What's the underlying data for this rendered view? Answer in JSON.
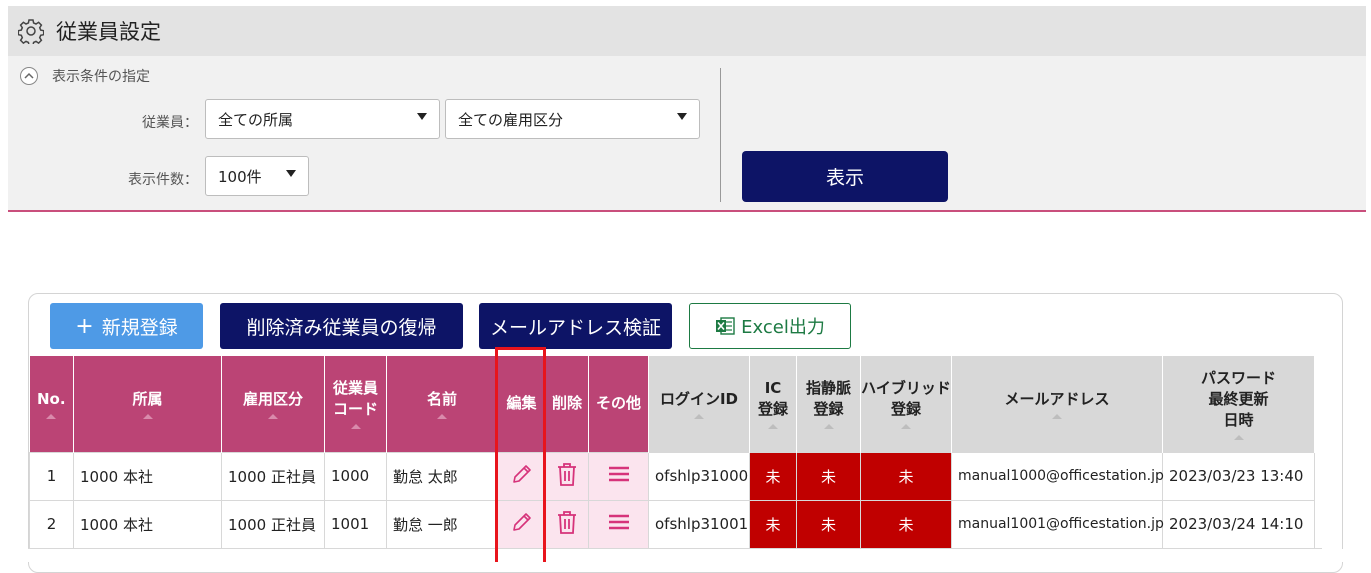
{
  "header": {
    "title": "従業員設定"
  },
  "filter": {
    "toggle_label": "表示条件の指定",
    "employee_label": "従業員：",
    "dept_select": "全ての所属",
    "employment_select": "全ての雇用区分",
    "count_label": "表示件数：",
    "count_select": "100件",
    "show_button": "表示"
  },
  "toolbar": {
    "new_label": "新規登録",
    "restore_label": "削除済み従業員の復帰",
    "verify_label": "メールアドレス検証",
    "excel_label": "Excel出力"
  },
  "table": {
    "headers": {
      "no": "No.",
      "dept": "所属",
      "employment": "雇用区分",
      "code_1": "従業員",
      "code_2": "コード",
      "name": "名前",
      "edit": "編集",
      "delete": "削除",
      "other": "その他",
      "login": "ログインID",
      "ic_1": "IC",
      "ic_2": "登録",
      "vein_1": "指静脈",
      "vein_2": "登録",
      "hybrid_1": "ハイブリッド",
      "hybrid_2": "登録",
      "email": "メールアドレス",
      "pw_1": "パスワード",
      "pw_2": "最終更新",
      "pw_3": "日時"
    },
    "rows": [
      {
        "no": "1",
        "dept": "1000 本社",
        "employment": "1000 正社員",
        "code": "1000",
        "name": "勤怠 太郎",
        "login": "ofshlp31000",
        "ic": "未",
        "vein": "未",
        "hybrid": "未",
        "email": "manual1000@officestation.jp",
        "pw_updated": "2023/03/23 13:40"
      },
      {
        "no": "2",
        "dept": "1000 本社",
        "employment": "1000 正社員",
        "code": "1001",
        "name": "勤怠 一郎",
        "login": "ofshlp31001",
        "ic": "未",
        "vein": "未",
        "hybrid": "未",
        "email": "manual1001@officestation.jp",
        "pw_updated": "2023/03/24 14:10"
      }
    ]
  },
  "colors": {
    "pink_header": "#bb4475",
    "navy_button": "#0d1466",
    "unregistered_red": "#c00000",
    "highlight": "#e8141c"
  },
  "icons": {
    "edit": "pencil-icon",
    "delete": "trash-icon",
    "other": "menu-icon",
    "settings": "gear-icon"
  }
}
